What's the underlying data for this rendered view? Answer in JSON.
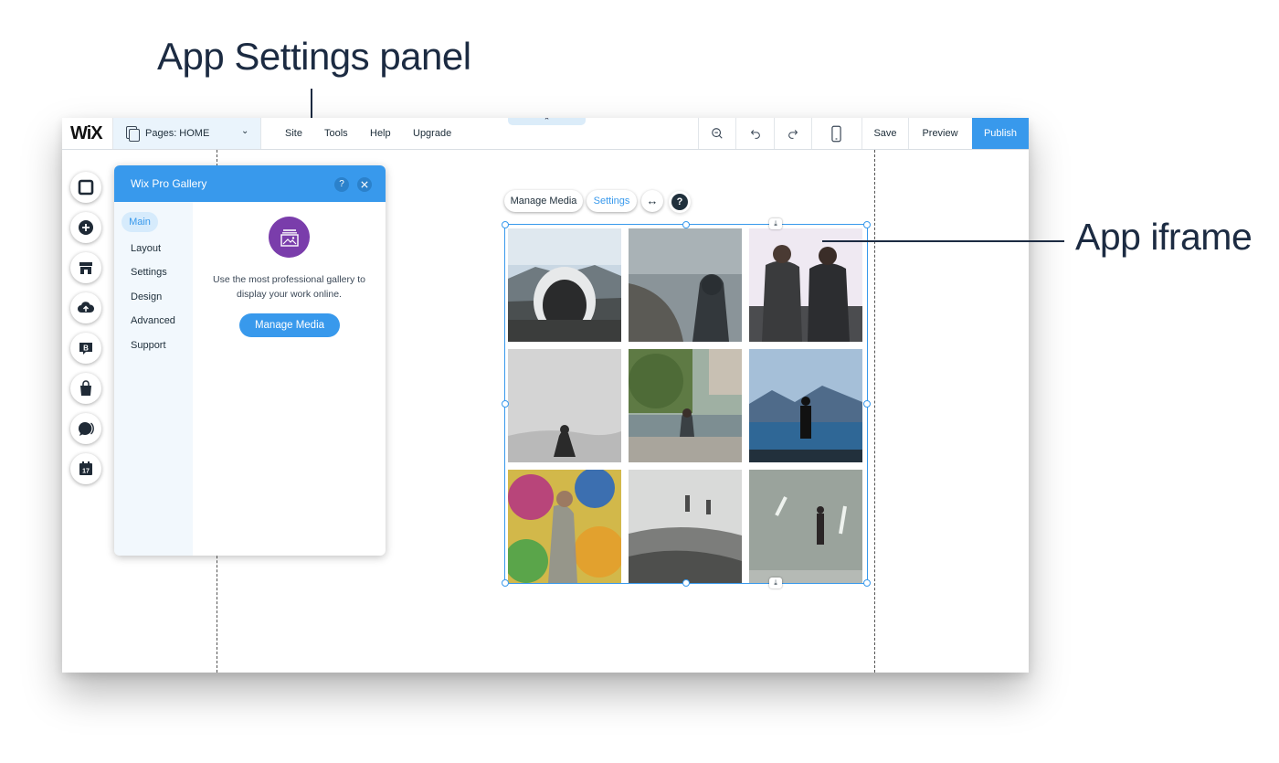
{
  "callouts": {
    "panel_label": "App Settings panel",
    "iframe_label": "App iframe"
  },
  "topbar": {
    "logo": "WiX",
    "pages_label": "Pages: HOME",
    "nav": [
      "Site",
      "Tools",
      "Help",
      "Upgrade"
    ],
    "save_label": "Save",
    "preview_label": "Preview",
    "publish_label": "Publish",
    "publish_color": "#3899ec"
  },
  "sidebar": {
    "icons": [
      "square-icon",
      "add-plus-icon",
      "store-icon",
      "upload-cloud-icon",
      "blog-b-icon",
      "shopping-bag-icon",
      "chat-icon",
      "calendar-17-icon"
    ],
    "calendar_day": "17",
    "blog_letter": "B"
  },
  "panel": {
    "title": "Wix Pro Gallery",
    "help": "?",
    "nav": [
      "Main",
      "Layout",
      "Settings",
      "Design",
      "Advanced",
      "Support"
    ],
    "active": "Main",
    "description": "Use the most professional gallery to display your work online.",
    "manage_label": "Manage Media",
    "icon_color": "#7a3dab"
  },
  "gallery_toolbar": {
    "manage_label": "Manage Media",
    "settings_label": "Settings",
    "help": "?"
  },
  "gallery": {
    "photos": [
      "airplane-wreck-snow",
      "hooded-person-beach",
      "two-men-balcony",
      "desert-silhouette",
      "man-sitting-river-wall",
      "man-at-lake-mountains",
      "graffiti-wall-person",
      "foggy-field-two-people",
      "man-walking-road"
    ]
  }
}
